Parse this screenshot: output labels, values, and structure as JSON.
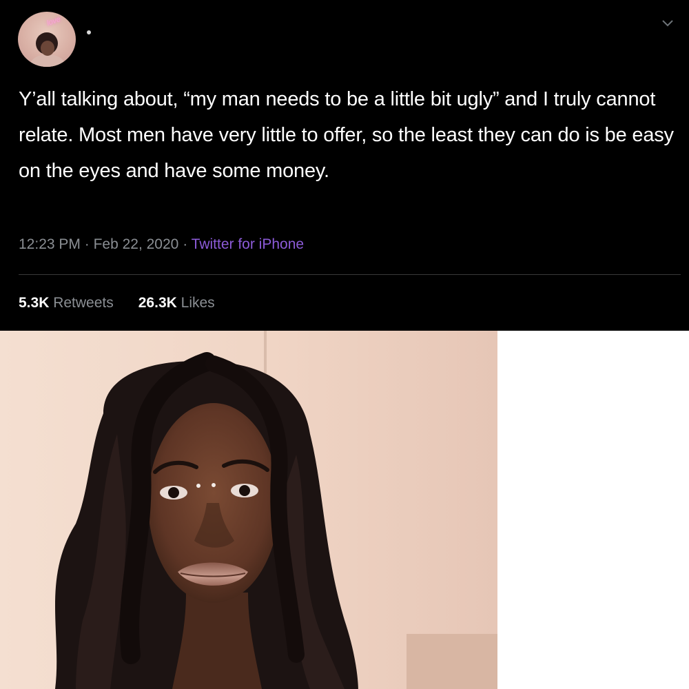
{
  "tweet": {
    "avatar_neon_text": "love",
    "username_placeholder": "·",
    "text": "Y’all talking about, “my man needs to be a little bit ugly” and I truly cannot relate. Most men have very little to offer, so the least they can do is be easy on the eyes and have some money.",
    "time": "12:23 PM",
    "date": "Feb 22, 2020",
    "separator": "·",
    "source": "Twitter for iPhone",
    "retweets_count": "5.3K",
    "retweets_label": "Retweets",
    "likes_count": "26.3K",
    "likes_label": "Likes",
    "colors": {
      "background": "#000000",
      "text": "#ffffff",
      "muted": "#8b8f94",
      "source_link": "#8c5bd8"
    }
  },
  "photo": {
    "icon": "selfie-photo"
  }
}
